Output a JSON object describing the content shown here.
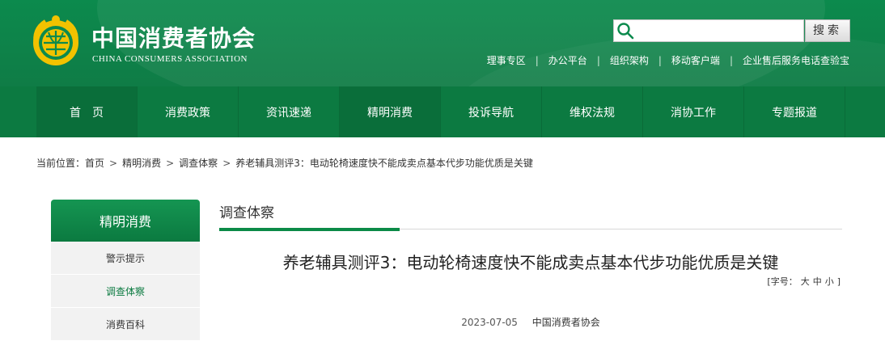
{
  "site": {
    "name_cn": "中国消费者协会",
    "name_en": "CHINA CONSUMERS ASSOCIATION"
  },
  "search": {
    "placeholder": "",
    "button_label": "搜索"
  },
  "toplinks": [
    "理事专区",
    "办公平台",
    "组织架构",
    "移动客户端",
    "企业售后服务电话查验宝"
  ],
  "nav": [
    "首页",
    "消费政策",
    "资讯速递",
    "精明消费",
    "投诉导航",
    "维权法规",
    "消协工作",
    "专题报道"
  ],
  "breadcrumb": {
    "prefix": "当前位置：",
    "items": [
      "首页",
      "精明消费",
      "调查体察",
      "养老辅具测评3：电动轮椅速度快不能成卖点基本代步功能优质是关键"
    ]
  },
  "sidebar": {
    "title": "精明消费",
    "items": [
      "警示提示",
      "调查体察",
      "消费百科"
    ]
  },
  "section_title": "调查体察",
  "article": {
    "title": "养老辅具测评3：电动轮椅速度快不能成卖点基本代步功能优质是关键",
    "fontsize_label": "[字号：",
    "fontsize_options": [
      "大",
      "中",
      "小"
    ],
    "fontsize_close": "]",
    "date": "2023-07-05",
    "source": "中国消费者协会"
  },
  "colors": {
    "brand_green": "#0c8a4d",
    "nav_green": "#0c7a41",
    "accent_gold": "#e8b400"
  }
}
